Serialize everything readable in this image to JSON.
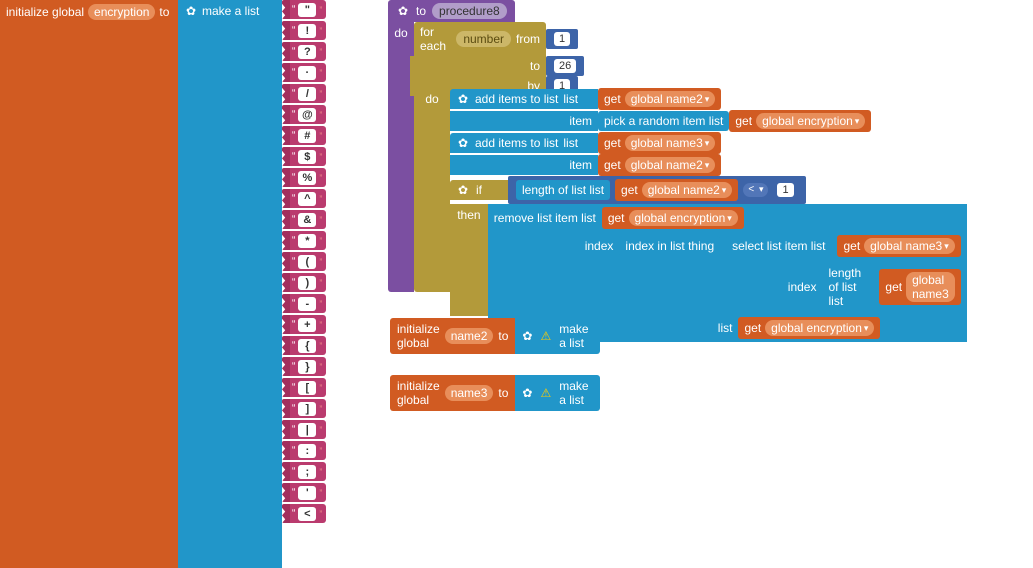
{
  "left": {
    "init_label": "initialize global",
    "var_name": "encryption",
    "to_label": "to",
    "make_list": "make a list"
  },
  "symbols": [
    "\"",
    "!",
    "?",
    "·",
    "/",
    "@",
    "#",
    "$",
    "%",
    "^",
    "&",
    "*",
    "(",
    ")",
    "-",
    "+",
    "{",
    "}",
    "[",
    "]",
    "|",
    ":",
    ";",
    "'",
    "<"
  ],
  "proc": {
    "to_label": "to",
    "name": "procedure8",
    "do_label": "do"
  },
  "for": {
    "each": "for each",
    "var": "number",
    "from": "from",
    "to": "to",
    "by": "by",
    "do": "do",
    "from_val": "1",
    "to_val": "26",
    "by_val": "1"
  },
  "add1": {
    "label": "add items to list",
    "list_lbl": "list",
    "item_lbl": "item",
    "get": "get",
    "var": "global name2",
    "pick": "pick a random item  list",
    "var2": "global encryption"
  },
  "add2": {
    "label": "add items to list",
    "list_lbl": "list",
    "item_lbl": "item",
    "get": "get",
    "var": "global name3",
    "var2": "global name2"
  },
  "if": {
    "if_lbl": "if",
    "then_lbl": "then",
    "len": "length of list  list",
    "get": "get",
    "var": "global name2",
    "op": "<",
    "val": "1"
  },
  "remove": {
    "label": "remove list item  list",
    "get": "get",
    "var": "global encryption",
    "index_lbl": "index",
    "iil": "index in list  thing",
    "select": "select list item  list",
    "index2": "index",
    "len": "length of list  list",
    "list_lbl": "list",
    "name3": "global name3",
    "enc": "global encryption"
  },
  "decl2": {
    "init": "initialize global",
    "var": "name2",
    "to": "to",
    "mk": "make a list"
  },
  "decl3": {
    "init": "initialize global",
    "var": "name3",
    "to": "to",
    "mk": "make a list"
  }
}
